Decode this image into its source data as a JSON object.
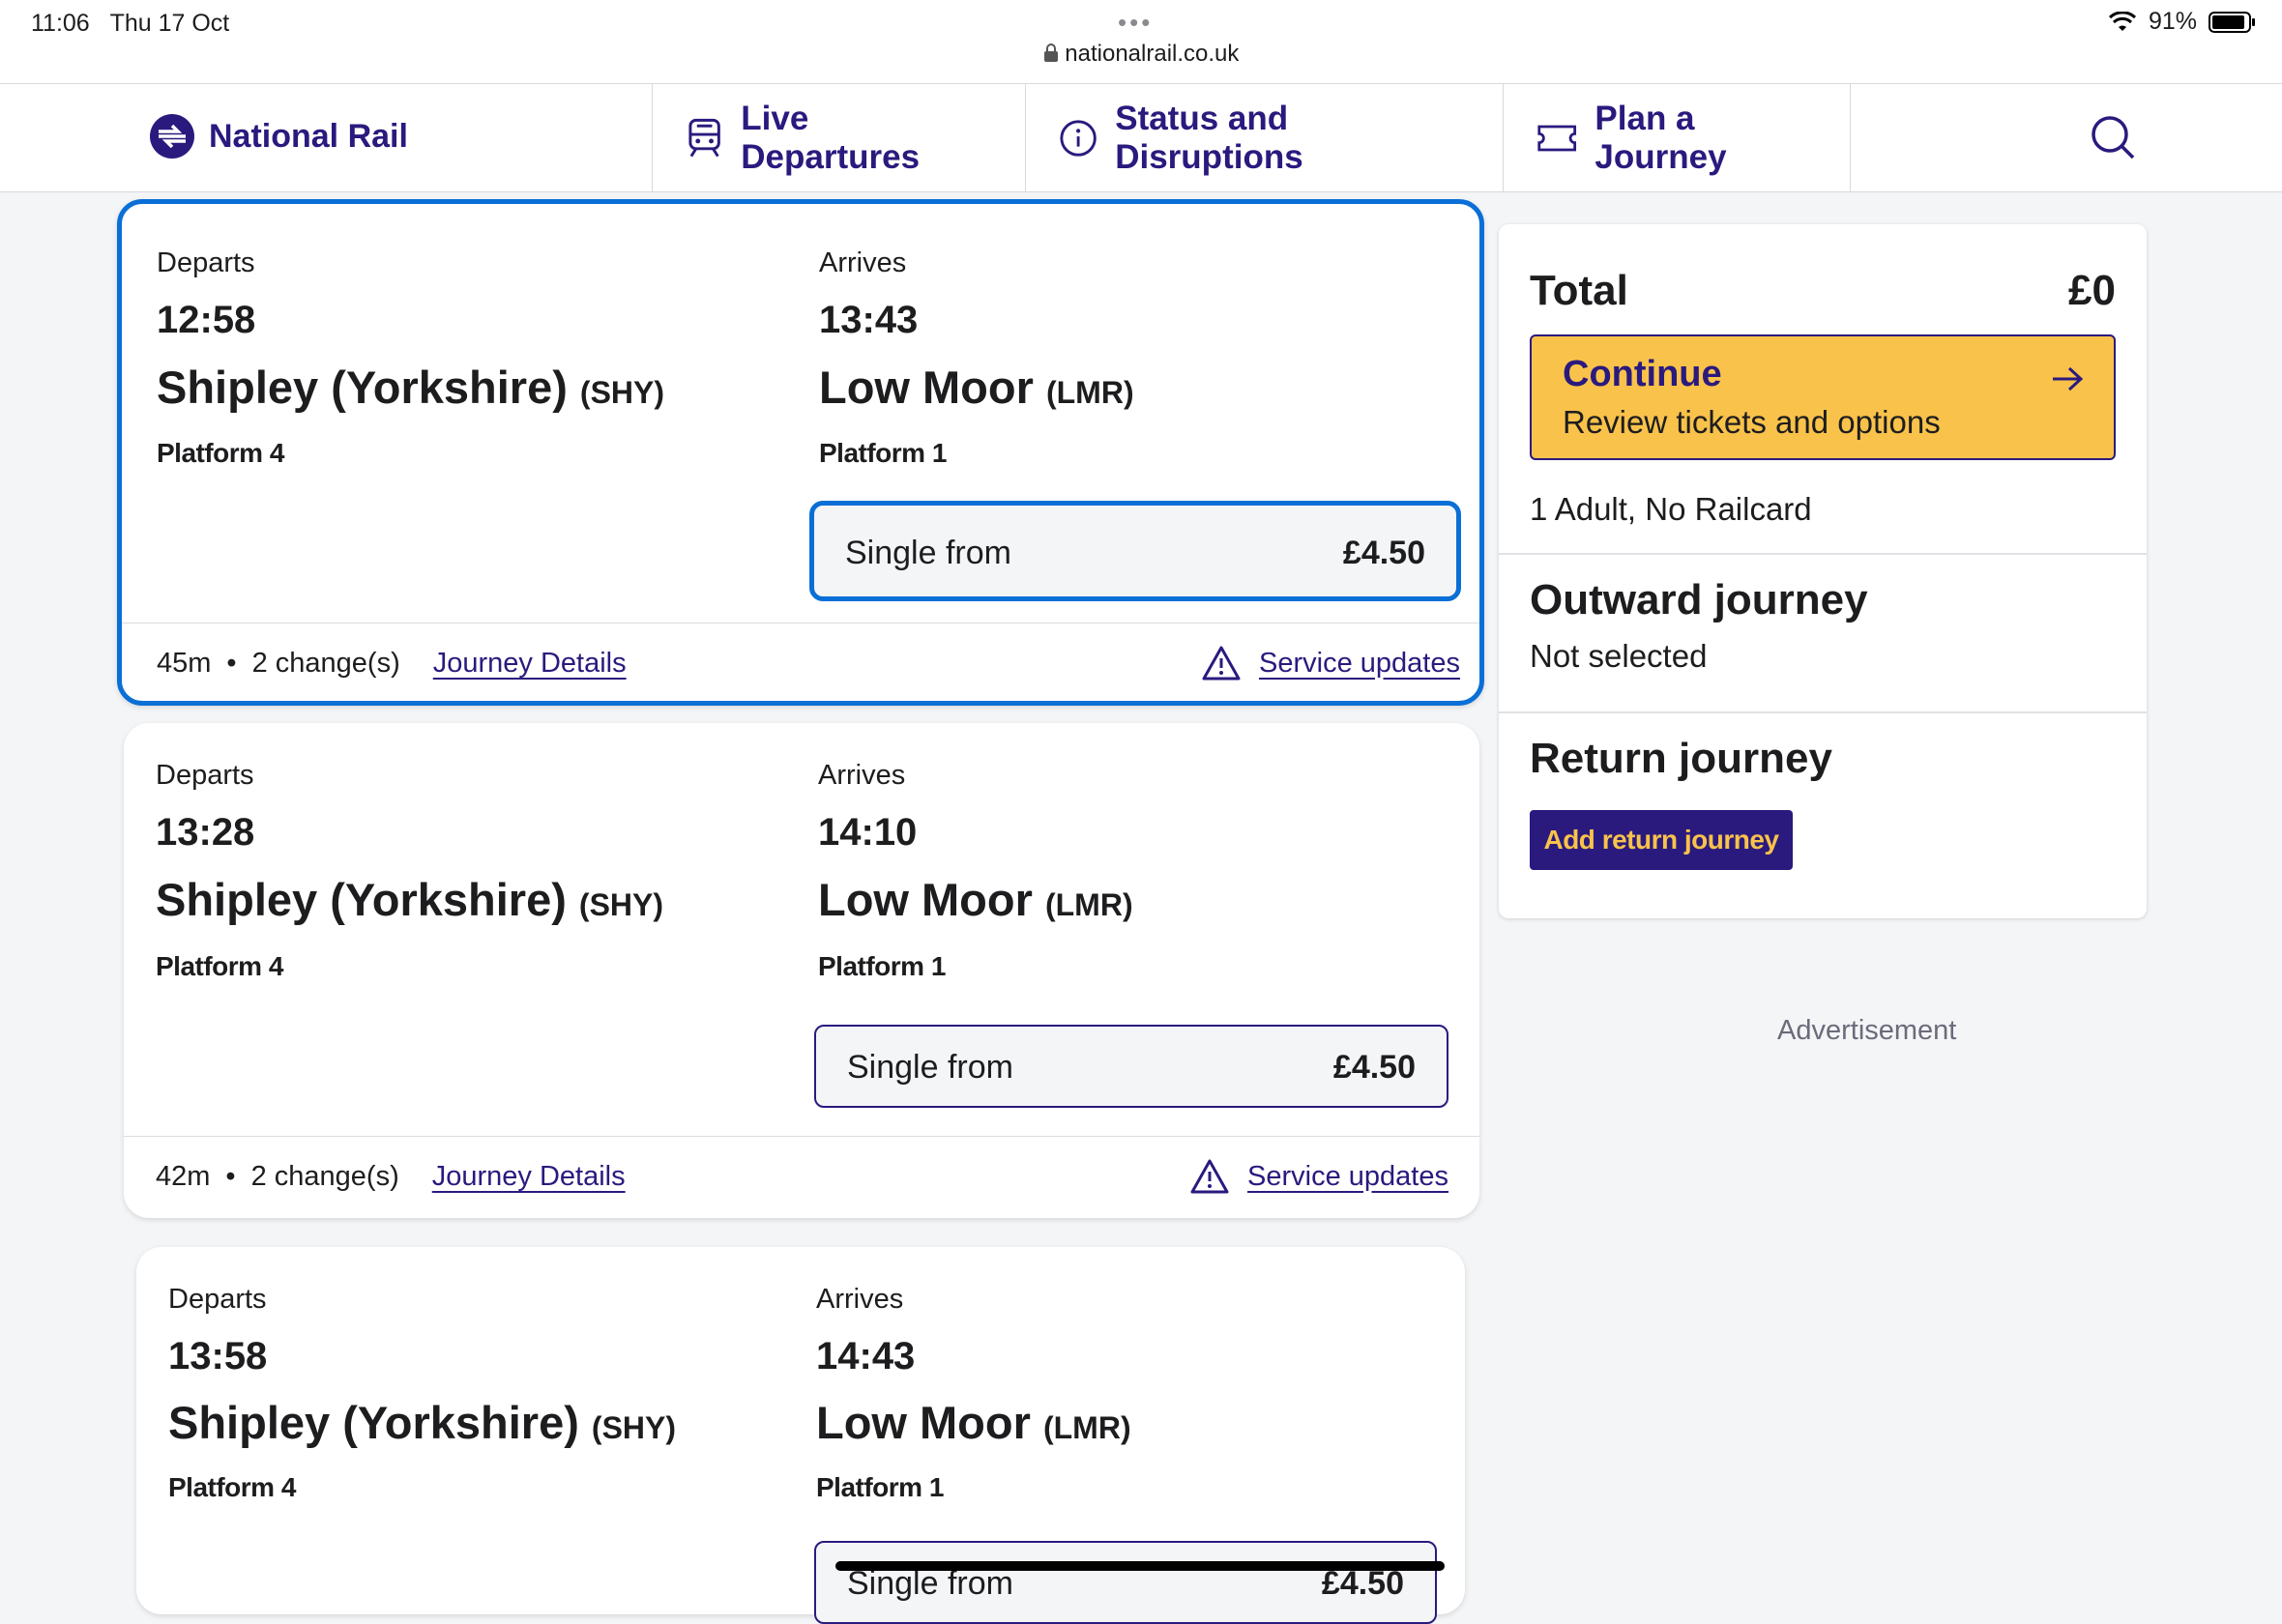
{
  "status_bar": {
    "time": "11:06",
    "date": "Thu 17 Oct",
    "url": "nationalrail.co.uk",
    "battery": "91%"
  },
  "nav": {
    "logo_text": "National Rail",
    "items": [
      {
        "label": "Live Departures",
        "icon": "train-icon"
      },
      {
        "label": "Status and Disruptions",
        "icon": "info-icon"
      },
      {
        "label": "Plan a Journey",
        "icon": "ticket-icon"
      }
    ]
  },
  "journeys": [
    {
      "departs_label": "Departs",
      "arrives_label": "Arrives",
      "dep_time": "12:58",
      "arr_time": "13:43",
      "origin": "Shipley (Yorkshire)",
      "origin_code": "(SHY)",
      "destination": "Low Moor",
      "destination_code": "(LMR)",
      "dep_platform": "Platform 4",
      "arr_platform": "Platform 1",
      "fare_label": "Single from",
      "fare_price": "£4.50",
      "duration": "45m",
      "changes": "2 change(s)",
      "details_link": "Journey Details",
      "service_link": "Service updates"
    },
    {
      "departs_label": "Departs",
      "arrives_label": "Arrives",
      "dep_time": "13:28",
      "arr_time": "14:10",
      "origin": "Shipley (Yorkshire)",
      "origin_code": "(SHY)",
      "destination": "Low Moor",
      "destination_code": "(LMR)",
      "dep_platform": "Platform 4",
      "arr_platform": "Platform 1",
      "fare_label": "Single from",
      "fare_price": "£4.50",
      "duration": "42m",
      "changes": "2 change(s)",
      "details_link": "Journey Details",
      "service_link": "Service updates"
    },
    {
      "departs_label": "Departs",
      "arrives_label": "Arrives",
      "dep_time": "13:58",
      "arr_time": "14:43",
      "origin": "Shipley (Yorkshire)",
      "origin_code": "(SHY)",
      "destination": "Low Moor",
      "destination_code": "(LMR)",
      "dep_platform": "Platform 4",
      "arr_platform": "Platform 1",
      "fare_label": "Single from",
      "fare_price": "£4.50"
    }
  ],
  "summary": {
    "total_label": "Total",
    "total_value": "£0",
    "continue_title": "Continue",
    "continue_sub": "Review tickets and options",
    "passengers": "1 Adult, No Railcard",
    "outward_title": "Outward journey",
    "outward_status": "Not selected",
    "return_title": "Return journey",
    "return_button": "Add return journey"
  },
  "advertisement": "Advertisement",
  "colors": {
    "brand": "#2a1a7e",
    "accent": "#f9c24a",
    "selected": "#0a6fd6"
  }
}
